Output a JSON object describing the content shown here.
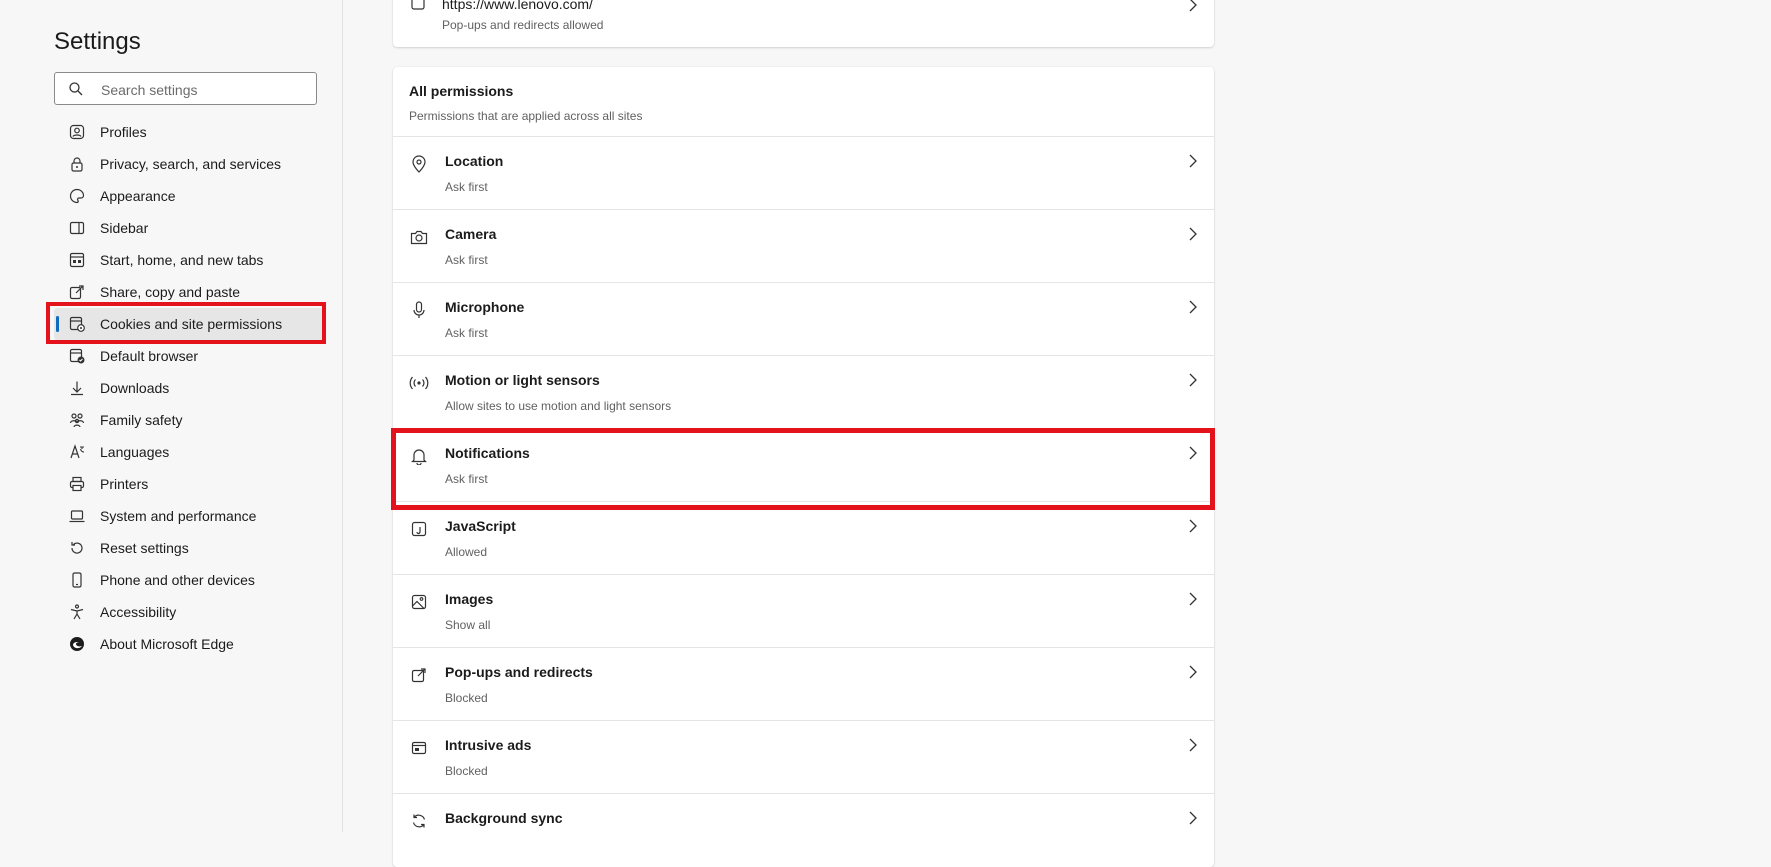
{
  "sidebar": {
    "title": "Settings",
    "search_placeholder": "Search settings",
    "items": [
      {
        "label": "Profiles",
        "icon": "profile-icon"
      },
      {
        "label": "Privacy, search, and services",
        "icon": "lock-icon"
      },
      {
        "label": "Appearance",
        "icon": "palette-icon"
      },
      {
        "label": "Sidebar",
        "icon": "sidebar-icon"
      },
      {
        "label": "Start, home, and new tabs",
        "icon": "home-tabs-icon"
      },
      {
        "label": "Share, copy and paste",
        "icon": "share-icon"
      },
      {
        "label": "Cookies and site permissions",
        "icon": "cookies-icon",
        "active": true
      },
      {
        "label": "Default browser",
        "icon": "default-browser-icon"
      },
      {
        "label": "Downloads",
        "icon": "download-icon"
      },
      {
        "label": "Family safety",
        "icon": "family-icon"
      },
      {
        "label": "Languages",
        "icon": "languages-icon"
      },
      {
        "label": "Printers",
        "icon": "printer-icon"
      },
      {
        "label": "System and performance",
        "icon": "laptop-icon"
      },
      {
        "label": "Reset settings",
        "icon": "reset-icon"
      },
      {
        "label": "Phone and other devices",
        "icon": "phone-icon"
      },
      {
        "label": "Accessibility",
        "icon": "accessibility-icon"
      },
      {
        "label": "About Microsoft Edge",
        "icon": "edge-logo-icon"
      }
    ]
  },
  "top_site": {
    "url": "https://www.lenovo.com/",
    "status": "Pop-ups and redirects allowed"
  },
  "permissions": {
    "title": "All permissions",
    "subtitle": "Permissions that are applied across all sites",
    "rows": [
      {
        "title": "Location",
        "status": "Ask first",
        "icon": "location-icon"
      },
      {
        "title": "Camera",
        "status": "Ask first",
        "icon": "camera-icon"
      },
      {
        "title": "Microphone",
        "status": "Ask first",
        "icon": "microphone-icon"
      },
      {
        "title": "Motion or light sensors",
        "status": "Allow sites to use motion and light sensors",
        "icon": "sensors-icon"
      },
      {
        "title": "Notifications",
        "status": "Ask first",
        "icon": "bell-icon",
        "highlighted": true
      },
      {
        "title": "JavaScript",
        "status": "Allowed",
        "icon": "javascript-icon"
      },
      {
        "title": "Images",
        "status": "Show all",
        "icon": "image-icon"
      },
      {
        "title": "Pop-ups and redirects",
        "status": "Blocked",
        "icon": "popup-icon"
      },
      {
        "title": "Intrusive ads",
        "status": "Blocked",
        "icon": "ads-icon"
      },
      {
        "title": "Background sync",
        "status": "",
        "icon": "sync-icon"
      }
    ]
  },
  "colors": {
    "accent": "#0f6cbd",
    "highlight_box": "#e3121b"
  }
}
